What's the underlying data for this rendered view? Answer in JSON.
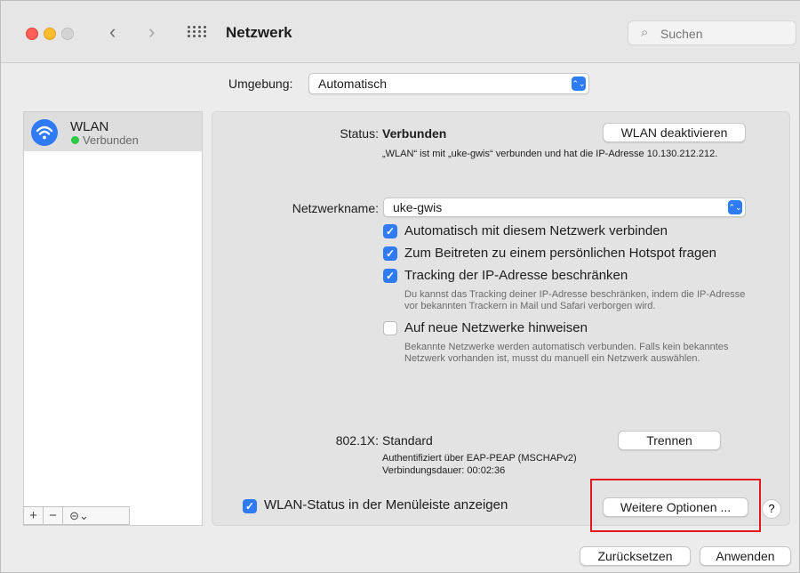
{
  "window": {
    "title": "Netzwerk",
    "back_glyph": "‹",
    "forward_glyph": "›",
    "search_placeholder": "Suchen",
    "search_icon_glyph": "⌕"
  },
  "location": {
    "label": "Umgebung:",
    "value": "Automatisch"
  },
  "sidebar": {
    "items": [
      {
        "name": "WLAN",
        "status": "Verbunden",
        "icon": "wifi-icon",
        "status_color": "#2dc945"
      }
    ],
    "controls": {
      "add": "+",
      "remove": "−",
      "action": "⊝⌄"
    }
  },
  "status": {
    "label": "Status:",
    "value": "Verbunden",
    "description": "„WLAN“ ist mit „uke-gwis“ verbunden und hat die IP-Adresse 10.130.212.212.",
    "toggle_button": "WLAN deaktivieren"
  },
  "network_name": {
    "label": "Netzwerkname:",
    "value": "uke-gwis"
  },
  "options": [
    {
      "label": "Automatisch mit diesem Netzwerk verbinden",
      "checked": true,
      "note": ""
    },
    {
      "label": "Zum Beitreten zu einem persönlichen Hotspot fragen",
      "checked": true,
      "note": ""
    },
    {
      "label": "Tracking der IP-Adresse beschränken",
      "checked": true,
      "note": "Du kannst das Tracking deiner IP-Adresse beschränken, indem die IP-Adresse vor bekannten Trackern in Mail und Safari verborgen wird."
    },
    {
      "label": "Auf neue Netzwerke hinweisen",
      "checked": false,
      "note": "Bekannte Netzwerke werden automatisch verbunden. Falls kein bekanntes Netzwerk vorhanden ist, musst du manuell ein Netzwerk auswählen."
    }
  ],
  "dot1x": {
    "label": "802.1X:",
    "value": "Standard",
    "auth": "Authentifiziert über EAP-PEAP (MSCHAPv2)",
    "duration": "Verbindungsdauer: 00:02:36",
    "disconnect_button": "Trennen"
  },
  "menubar": {
    "label": "WLAN-Status in der Menüleiste anzeigen",
    "checked": true
  },
  "buttons": {
    "advanced": "Weitere Optionen ...",
    "help": "?",
    "revert": "Zurücksetzen",
    "apply": "Anwenden"
  },
  "colors": {
    "accent": "#2f7bf5",
    "highlight": "#e3191c",
    "connected": "#2dc945"
  }
}
